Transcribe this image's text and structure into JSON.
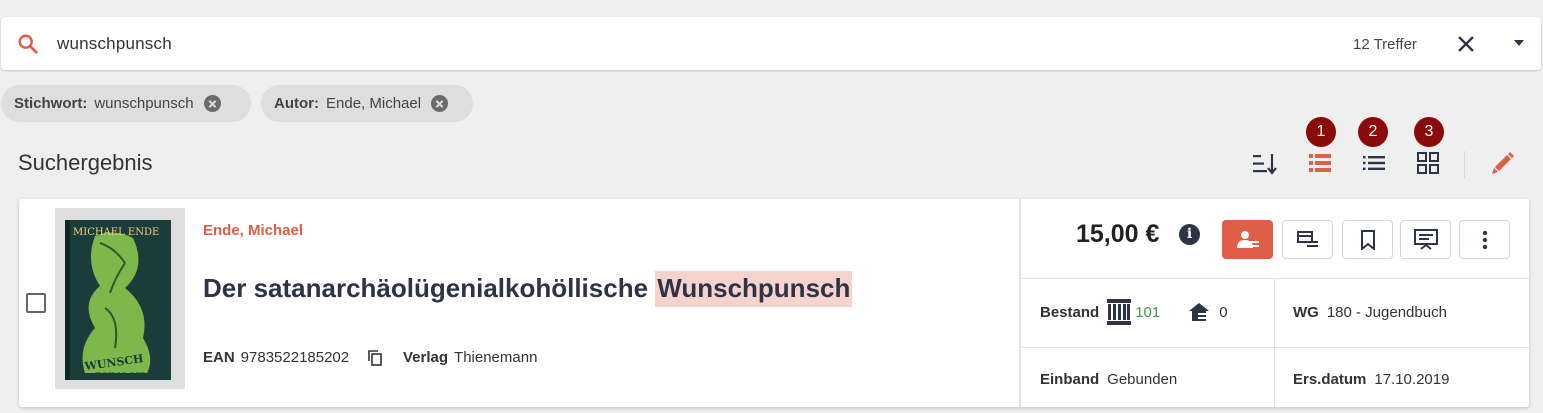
{
  "search": {
    "query": "wunschpunsch",
    "hits": "12 Treffer"
  },
  "filters": [
    {
      "label": "Stichwort:",
      "value": "wunschpunsch"
    },
    {
      "label": "Autor:",
      "value": "Ende, Michael"
    }
  ],
  "results": {
    "heading": "Suchergebnis",
    "badges": [
      "1",
      "2",
      "3"
    ]
  },
  "item": {
    "author": "Ende, Michael",
    "title_main": "Der satanarchäolügenialkohöllische",
    "title_highlight": "Wunschpunsch",
    "ean_label": "EAN",
    "ean": "9783522185202",
    "publisher_label": "Verlag",
    "publisher": "Thienemann",
    "price": "15,00 €",
    "stock_label": "Bestand",
    "stock_libri": "101",
    "stock_home": "0",
    "wg_label": "WG",
    "wg": "180 - Jugendbuch",
    "binding_label": "Einband",
    "binding": "Gebunden",
    "date_label": "Ers.datum",
    "date": "17.10.2019",
    "cover": {
      "author_text": "MICHAEL ENDE",
      "title_text": "DER SATAN WUNSCHPUNSCH"
    }
  },
  "colors": {
    "accent": "#e05d47",
    "badge": "#8b0a0a",
    "highlight": "#f7d3cd",
    "stock_green": "#3a9a45"
  },
  "icons": [
    "search-icon",
    "close-icon",
    "chevron-down-icon",
    "sort-icon",
    "table-view-icon",
    "list-view-icon",
    "grid-view-icon",
    "edit-icon",
    "info-icon",
    "order-customer-icon",
    "cart-icon",
    "bookmark-icon",
    "pickup-icon",
    "more-vertical-icon",
    "copy-icon",
    "libri-icon",
    "home-stock-icon"
  ]
}
